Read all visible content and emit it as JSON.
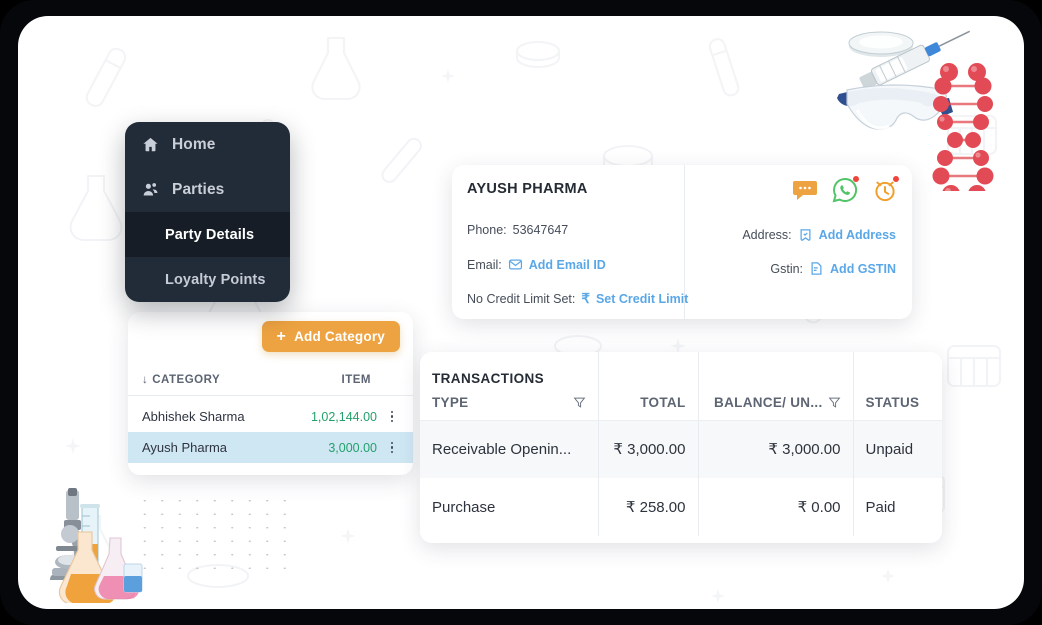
{
  "sidebar": {
    "items": [
      {
        "label": "Home",
        "icon": "home-icon",
        "level": "top",
        "active": false
      },
      {
        "label": "Parties",
        "icon": "people-icon",
        "level": "top",
        "active": false
      },
      {
        "label": "Party Details",
        "icon": "",
        "level": "sub",
        "active": true
      },
      {
        "label": "Loyalty Points",
        "icon": "",
        "level": "sub",
        "active": false
      }
    ]
  },
  "category_panel": {
    "add_button": {
      "label": "Add Category",
      "plus": "+"
    },
    "columns": {
      "category": "CATEGORY",
      "item": "ITEM",
      "sort_arrow": "↓"
    },
    "rows": [
      {
        "name": "Abhishek Sharma",
        "amount": "1,02,144.00"
      },
      {
        "name": "Ayush Pharma",
        "amount": "3,000.00"
      }
    ]
  },
  "party": {
    "name": "AYUSH PHARMA",
    "phone_label": "Phone:",
    "phone_value": "53647647",
    "email_label": "Email:",
    "email_link": "Add Email ID",
    "credit_label": "No Credit Limit Set:",
    "credit_symbol": "₹",
    "credit_link": "Set Credit Limit",
    "address_label": "Address:",
    "address_link": "Add Address",
    "gstin_label": "Gstin:",
    "gstin_link": "Add GSTIN",
    "actions": [
      {
        "icon": "sms-chat-icon",
        "badge": false
      },
      {
        "icon": "whatsapp-icon",
        "badge": true
      },
      {
        "icon": "alarm-clock-icon",
        "badge": true
      }
    ]
  },
  "transactions": {
    "title": "TRANSACTIONS",
    "columns": [
      "TYPE",
      "TOTAL",
      "BALANCE/ UN...",
      "STATUS"
    ],
    "rows": [
      {
        "type": "Receivable Openin...",
        "total": "₹ 3,000.00",
        "balance": "₹ 3,000.00",
        "status": "Unpaid"
      },
      {
        "type": "Purchase",
        "total": "₹ 258.00",
        "balance": "₹ 0.00",
        "status": "Paid"
      }
    ]
  },
  "colors": {
    "accent_orange": "#eda341",
    "link_blue": "#5aa7e8",
    "amount_green": "#24a06b",
    "row_highlight": "#cfe6f3",
    "sidebar_bg": "#222b38",
    "sidebar_active": "#171d27",
    "badge_red": "#f0443a",
    "whatsapp_green": "#52c468"
  }
}
